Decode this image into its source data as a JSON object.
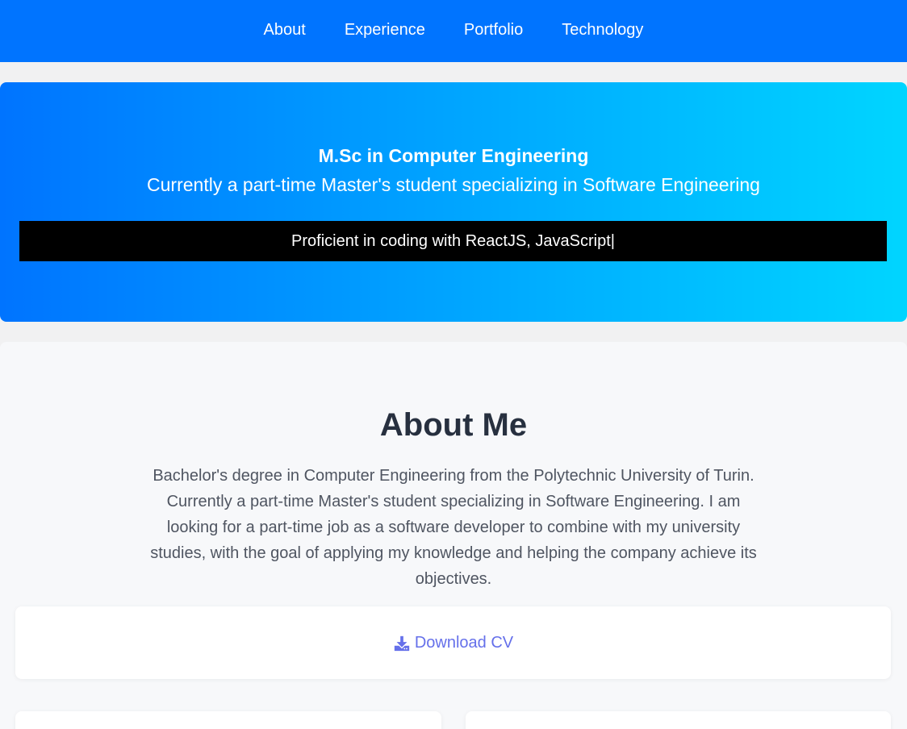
{
  "nav": {
    "items": [
      {
        "label": "About"
      },
      {
        "label": "Experience"
      },
      {
        "label": "Portfolio"
      },
      {
        "label": "Technology"
      }
    ]
  },
  "hero": {
    "title": "M.Sc in Computer Engineering",
    "subtitle": "Currently a part-time Master's student specializing in Software Engineering",
    "typing_text": "Proficient in coding with ReactJS, JavaScript",
    "cursor": "|"
  },
  "about": {
    "title": "About Me",
    "description": "Bachelor's degree in Computer Engineering from the Polytechnic University of Turin. Currently a part-time Master's student specializing in Software Engineering. I am looking for a part-time job as a software developer to combine with my university studies, with the goal of applying my knowledge and helping the company achieve its objectives.",
    "download_label": "Download CV",
    "download_icon": "download-icon"
  },
  "colors": {
    "nav_bg": "#0074ff",
    "hero_gradient_start": "#0074ff",
    "hero_gradient_end": "#00d5ff",
    "link": "#6570ea",
    "heading": "#27303f"
  }
}
